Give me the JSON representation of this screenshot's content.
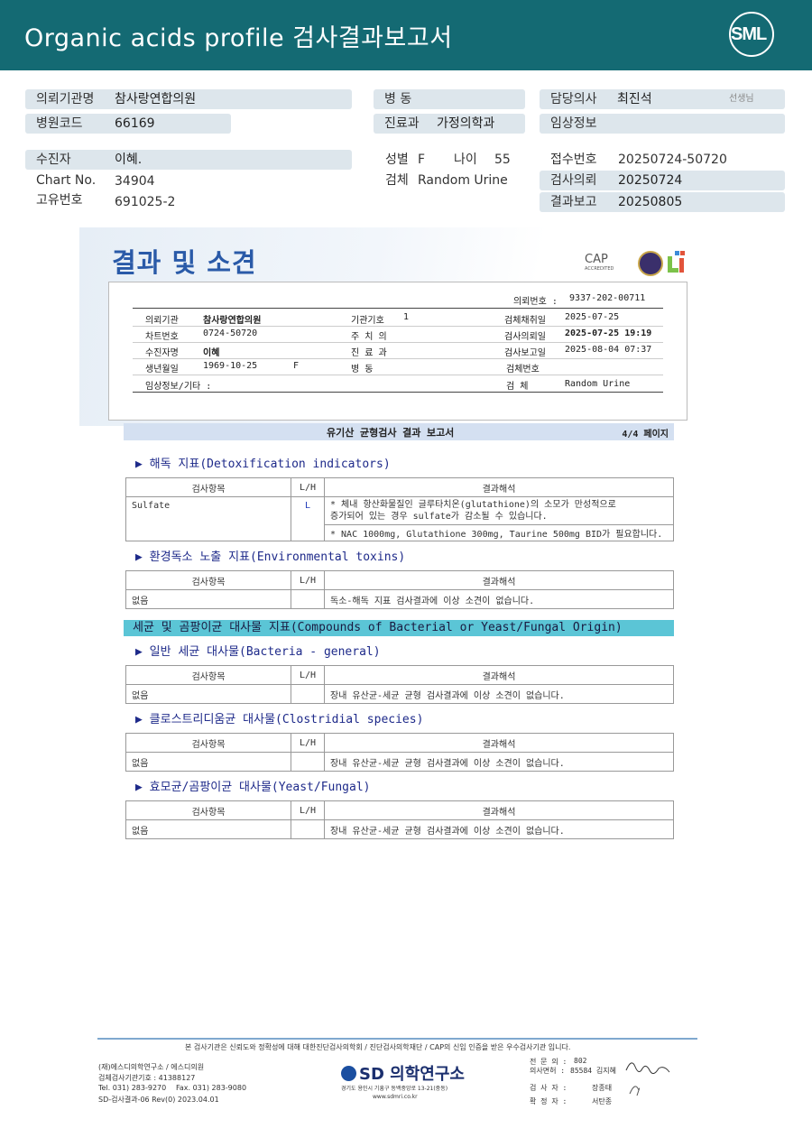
{
  "header": {
    "title": "Organic acids profile 검사결과보고서",
    "logo": "SML"
  },
  "patient": {
    "inst_label": "의뢰기관명",
    "inst_value": "참사랑연합의원",
    "code_label": "병원코드",
    "code_value": "66169",
    "ward_label": "병  동",
    "dept_label": "진료과",
    "dept_value": "가정의학과",
    "doctor_label": "담당의사",
    "doctor_value": "최진석",
    "doctor_suffix": "선생님",
    "clinical_label": "임상정보",
    "name_label": "수진자",
    "name_value": "이혜.",
    "chart_label": "Chart No.",
    "chart_value": "34904",
    "id_label": "고유번호",
    "id_value": "691025-2",
    "sex_label": "성별",
    "sex_value": "F",
    "age_label": "나이",
    "age_value": "55",
    "spec_label": "검체",
    "spec_value": "Random Urine",
    "recv_label": "접수번호",
    "recv_value": "20250724-50720",
    "req_label": "검사의뢰",
    "req_value": "20250724",
    "rep_label": "결과보고",
    "rep_value": "20250805"
  },
  "report": {
    "title": "결과 및 소견",
    "cap": "CAP",
    "cap_sub": "ACCREDITED",
    "request_no_label": "의뢰번호 :",
    "request_no": "9337-202-00711",
    "rows": [
      {
        "k1": "의뢰기관",
        "v1": "참사랑연합의원",
        "k2": "기관기호",
        "v2": "1",
        "k3": "검체채취일",
        "v3": "2025-07-25"
      },
      {
        "k1": "차트번호",
        "v1": "0724-50720",
        "k2": "주 치 의",
        "v2": "",
        "k3": "검사의뢰일",
        "v3": "2025-07-25 19:19"
      },
      {
        "k1": "수진자명",
        "v1": "이혜",
        "k2": "진 료 과",
        "v2": "",
        "k3": "검사보고일",
        "v3": "2025-08-04 07:37"
      },
      {
        "k1": "생년월일",
        "v1": "1969-10-25",
        "v1b": "F",
        "k2": "병    동",
        "v2": "",
        "k3": "검체번호",
        "v3": ""
      }
    ],
    "clinical_label": "임상정보/기타 :",
    "spec_label": "검    체",
    "spec_value": "Random Urine",
    "main_title": "유기산 균형검사 결과 보고서",
    "page": "4/4 페이지"
  },
  "columns": {
    "item": "검사항목",
    "lh": "L/H",
    "interp": "결과해석"
  },
  "sections": {
    "detox": {
      "title": "▶ 해독 지표(Detoxification indicators)",
      "item": "Sulfate",
      "lh": "L",
      "line1": "* 체내 항산화물질인 글루타치온(glutathione)의 소모가 만성적으로",
      "line2": "증가되어 있는 경우 sulfate가 감소될 수 있습니다.",
      "line3": "* NAC 1000mg, Glutathione 300mg, Taurine 500mg BID가 필요합니다."
    },
    "env": {
      "title": "▶ 환경독소 노출 지표(Environmental toxins)",
      "item": "없음",
      "text": "독소-해독 지표 검사결과에 이상 소견이 없습니다."
    },
    "bact_header": "세균 및 곰팡이균 대사물 지표(Compounds of Bacterial or Yeast/Fungal Origin)",
    "bact": {
      "title": "▶ 일반 세균 대사물(Bacteria - general)",
      "item": "없음",
      "text": "장내 유산균-세균 균형 검사결과에 이상 소견이 없습니다."
    },
    "clos": {
      "title": "▶ 클로스트리디움균 대사물(Clostridial species)",
      "item": "없음",
      "text": "장내 유산균-세균 균형 검사결과에 이상 소견이 없습니다."
    },
    "yeast": {
      "title": "▶ 효모균/곰팡이균 대사물(Yeast/Fungal)",
      "item": "없음",
      "text": "장내 유산균-세균 균형 검사결과에 이상 소견이 없습니다."
    }
  },
  "footer": {
    "notice": "본 검사기관은 신뢰도와 정확성에 대해 대한진단검사의학회 / 진단검사의학재단 / CAP의 신임 인증을 받은 우수검사기관 입니다.",
    "org1": "(재)에스디의학연구소 / 에스디의원",
    "org2": "검체검사기관기호 : 41388127",
    "tel": "Tel. 031) 283-9270",
    "fax": "Fax. 031) 283-9080",
    "form": "SD-검사결과-06 Rev(0) 2023.04.01",
    "brand": "SD 의학연구소",
    "addr": "경기도 용인시 기흥구 동백중앙로 13-21(중동)",
    "web": "www.sdmri.co.kr",
    "spec_label": "전 문 의 :",
    "spec_no": "802",
    "lic_label": "의사면허 :",
    "lic_no": "85584 김지혜",
    "tester_label": "검 사 자 :",
    "tester": "장종태",
    "confirm_label": "확 정 자 :",
    "confirmer": "서탄종"
  }
}
